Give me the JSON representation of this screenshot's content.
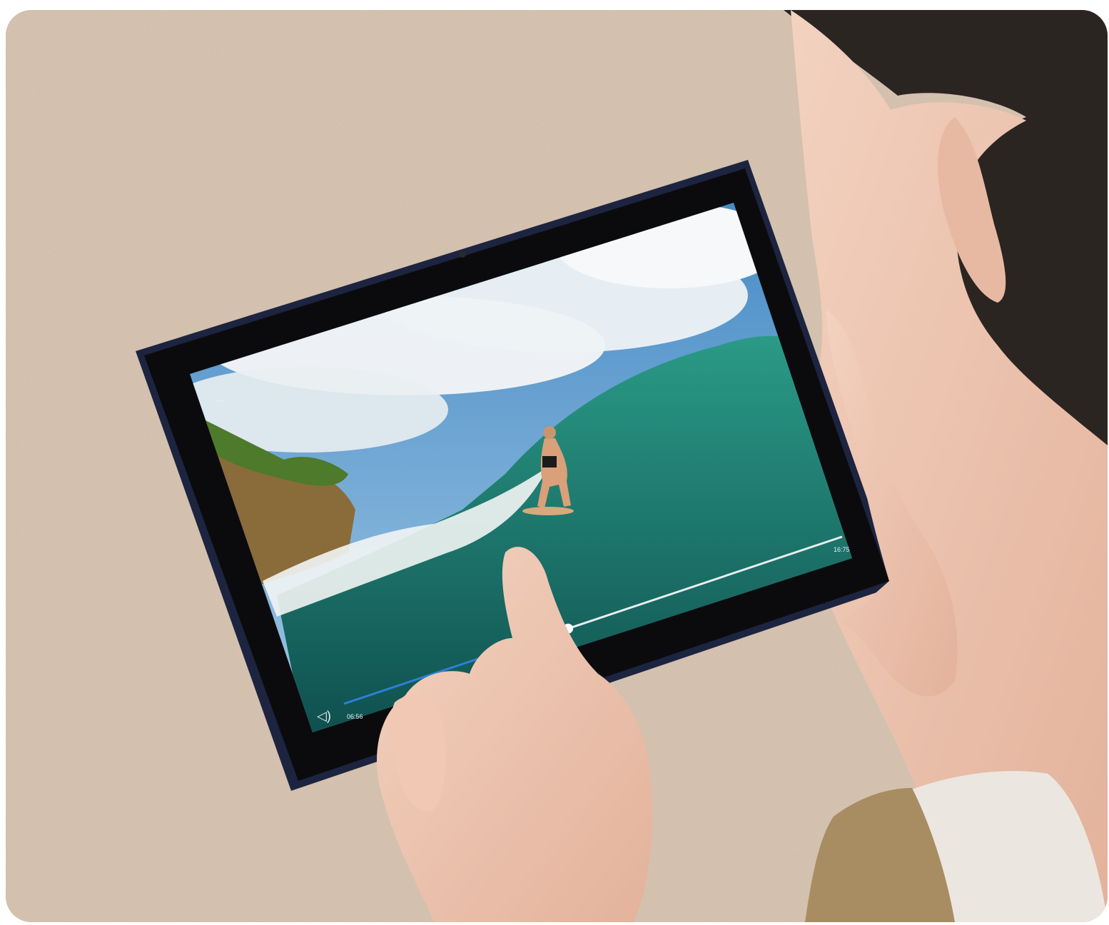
{
  "player": {
    "elapsed_time": "06:56",
    "total_time": "16:75",
    "progress": 0.45
  },
  "icons": {
    "back": "back-arrow-icon",
    "volume": "volume-icon"
  },
  "colors": {
    "carpet": "#cdb8a4",
    "tablet_frame": "#1c2440",
    "bezel": "#0b0b0d",
    "sea": "#1f7d72",
    "sky": "#5f9fd0",
    "progress_played": "#2e7fd6",
    "progress_remaining": "#e8eef2"
  }
}
